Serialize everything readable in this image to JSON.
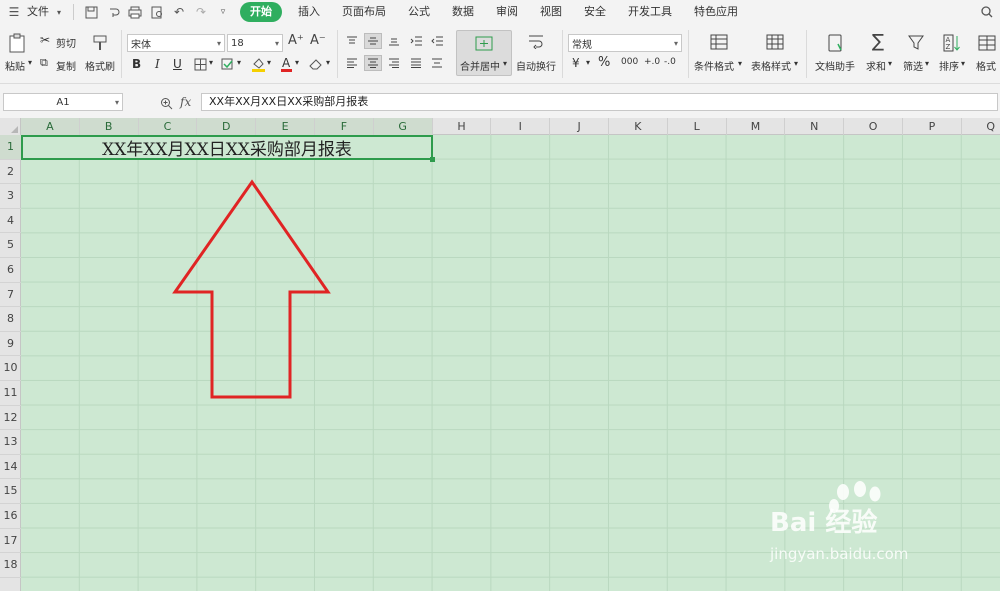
{
  "menubar": {
    "file_label": "文件",
    "tabs": [
      "开始",
      "插入",
      "页面布局",
      "公式",
      "数据",
      "审阅",
      "视图",
      "安全",
      "开发工具",
      "特色应用"
    ],
    "active_tab": "开始"
  },
  "ribbon": {
    "paste_label": "粘贴",
    "cut_label": "剪切",
    "copy_label": "复制",
    "format_painter_label": "格式刷",
    "font_name": "宋体",
    "font_size": "18",
    "merge_center_label": "合并居中",
    "wrap_text_label": "自动换行",
    "number_format": "常规",
    "conditional_format_label": "条件格式",
    "table_style_label": "表格样式",
    "doc_helper_label": "文档助手",
    "sum_label": "求和",
    "filter_label": "筛选",
    "sort_label": "排序",
    "format_label": "格式",
    "bold": "B",
    "italic": "I",
    "underline": "U",
    "percent": "%",
    "thousands": "000",
    "inc_decimal": "+.0",
    "dec_decimal": "-.0",
    "grow_font": "A⁺",
    "shrink_font": "A⁻"
  },
  "formula_bar": {
    "cell_ref": "A1",
    "fx_label": "fx",
    "content": "XX年XX月XX日XX采购部月报表"
  },
  "sheet": {
    "columns": [
      "A",
      "B",
      "C",
      "D",
      "E",
      "F",
      "G",
      "H",
      "I",
      "J",
      "K",
      "L",
      "M",
      "N",
      "O",
      "P",
      "Q"
    ],
    "rows": [
      "1",
      "2",
      "3",
      "4",
      "5",
      "6",
      "7",
      "8",
      "9",
      "10",
      "11",
      "12",
      "13",
      "14",
      "15",
      "16",
      "17",
      "18"
    ],
    "merged_cell_text": "XX年XX月XX日XX采购部月报表"
  },
  "colors": {
    "accent": "#2fae5f",
    "grid_background": "#cde8d2",
    "annotation_arrow": "#e02424"
  },
  "watermark": {
    "word": "Bai 经验",
    "url": "jingyan.baidu.com"
  }
}
